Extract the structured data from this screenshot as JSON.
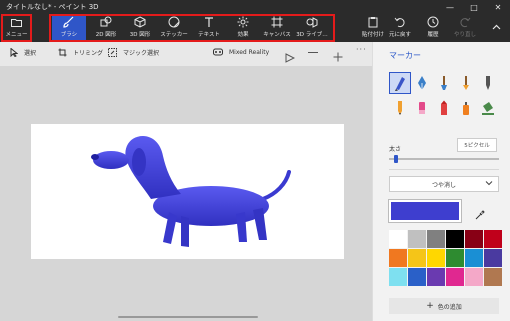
{
  "window": {
    "title": "タイトルなし* - ペイント 3D",
    "minimize": "—",
    "maximize": "□",
    "close": "✕"
  },
  "ribbon": {
    "menu": "メニュー",
    "tools": [
      {
        "label": "ブラシ",
        "icon": "brush-icon",
        "active": true
      },
      {
        "label": "2D 図形",
        "icon": "2d-shapes-icon"
      },
      {
        "label": "3D 図形",
        "icon": "3d-shapes-icon"
      },
      {
        "label": "ステッカー",
        "icon": "stickers-icon"
      },
      {
        "label": "テキスト",
        "icon": "text-icon"
      },
      {
        "label": "効果",
        "icon": "effects-icon"
      },
      {
        "label": "キャンバス",
        "icon": "canvas-icon"
      },
      {
        "label": "3D ライブ…",
        "icon": "3d-library-icon"
      }
    ],
    "actions": [
      {
        "label": "貼付付け",
        "icon": "paste-icon"
      },
      {
        "label": "元に戻す",
        "icon": "undo-icon"
      },
      {
        "label": "履歴",
        "icon": "history-icon"
      },
      {
        "label": "やり直し",
        "icon": "redo-icon",
        "disabled": true
      }
    ]
  },
  "subbar": {
    "select": "選択",
    "trim": "トリミング",
    "magic_select": "マジック選択",
    "mixed_reality": "Mixed Reality"
  },
  "panel": {
    "title": "マーカー",
    "thickness_label": "太さ",
    "thickness_value": "5ピクセル",
    "finish": "つや消し",
    "add_color": "色の追加",
    "current_color": "#3e3ecf",
    "brushes": [
      {
        "name": "marker",
        "color": "#3a55c8"
      },
      {
        "name": "calligraphy-pen",
        "color": "#3a7fc8"
      },
      {
        "name": "oil-brush",
        "color": "#3a7fc8"
      },
      {
        "name": "watercolor",
        "color": "#f0a030"
      },
      {
        "name": "pixel-pen",
        "color": "#555555"
      },
      {
        "name": "pencil",
        "color": "#f0a030"
      },
      {
        "name": "eraser",
        "color": "#e34a8a"
      },
      {
        "name": "crayon",
        "color": "#e04040"
      },
      {
        "name": "spray-can",
        "color": "#f08020"
      },
      {
        "name": "fill",
        "color": "#4a8a4a"
      }
    ],
    "swatches": [
      "#ffffff",
      "#c0c0c0",
      "#808080",
      "#000000",
      "#880015",
      "#c0001b",
      "#f07820",
      "#f5c518",
      "#ffd700",
      "#2e8b30",
      "#1a8fd4",
      "#4a3aa0",
      "#7ee0f0",
      "#2a60c8",
      "#6a3ab0",
      "#e02890",
      "#f4a8c8",
      "#b07850"
    ]
  },
  "accent": "#2f56c8",
  "annotation_color": "#e41b1b"
}
